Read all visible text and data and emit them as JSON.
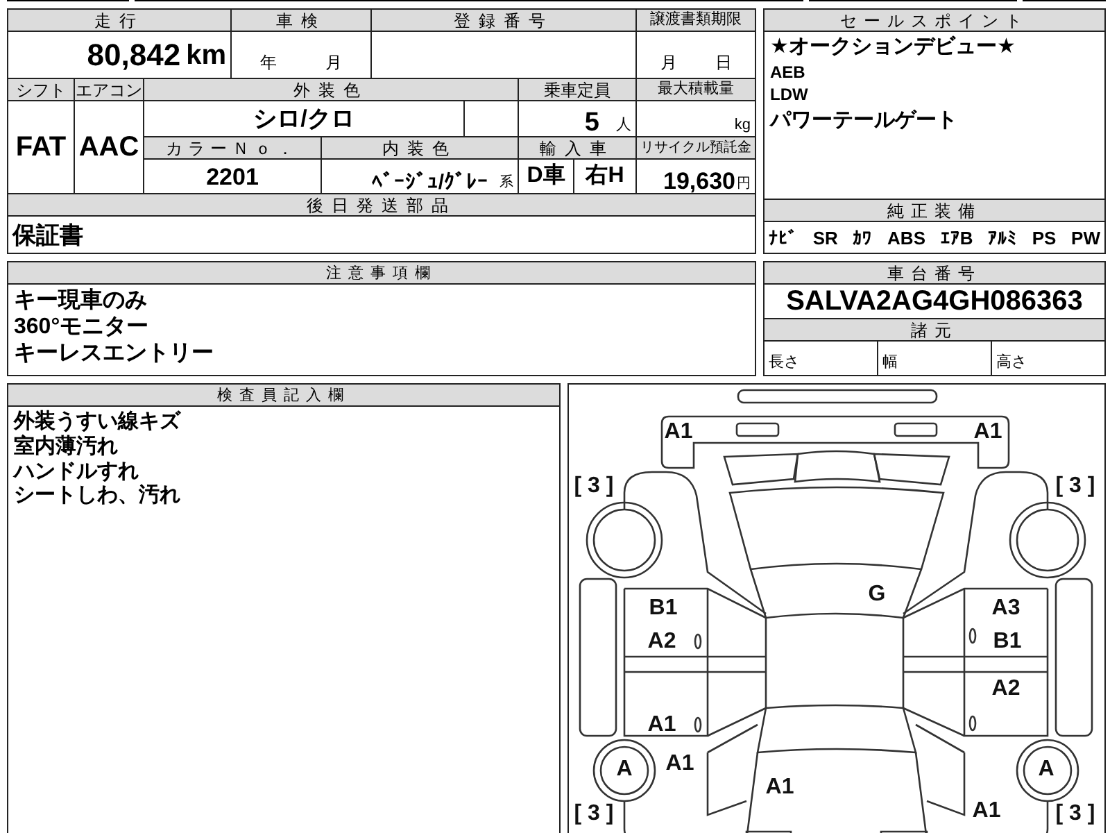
{
  "top_table": {
    "mileage": {
      "label": "走行",
      "value": "80,842",
      "unit": "km"
    },
    "inspection": {
      "label": "車検",
      "year_unit": "年",
      "month_unit": "月"
    },
    "registration_number": {
      "label": "登録番号"
    },
    "transfer_deadline": {
      "label": "譲渡書類期限",
      "month_unit": "月",
      "day_unit": "日"
    },
    "shift": {
      "label": "シフト",
      "value": "FAT"
    },
    "air_conditioning": {
      "label": "エアコン",
      "value": "AAC"
    },
    "exterior_color": {
      "label": "外装色",
      "value": "シロ/クロ"
    },
    "seating_capacity": {
      "label": "乗車定員",
      "value": "5",
      "unit": "人"
    },
    "max_load": {
      "label": "最大積載量",
      "unit": "kg"
    },
    "color_number": {
      "label": "カラーＮｏ．",
      "value": "2201"
    },
    "interior_color": {
      "label": "内装色",
      "value": "ﾍﾞｰｼﾞｭ/ｸﾞﾚｰ",
      "suffix": "系"
    },
    "import": {
      "label": "輸入車",
      "values": [
        "D車",
        "右H"
      ]
    },
    "recycling_fee": {
      "label": "リサイクル預託金",
      "value": "19,630",
      "unit": "円"
    },
    "later_parts": {
      "label": "後日発送部品",
      "value": "保証書"
    }
  },
  "sales_points": {
    "label": "セールスポイント",
    "items": [
      "★オークションデビュー★",
      "AEB",
      "LDW",
      "パワーテールゲート"
    ]
  },
  "equipment": {
    "label": "純正装備",
    "items": [
      "ﾅﾋﾞ",
      "SR",
      "ｶﾜ",
      "ABS",
      "ｴｱB",
      "ｱﾙﾐ",
      "PS",
      "PW"
    ]
  },
  "notes": {
    "label": "注意事項欄",
    "lines": [
      "キー現車のみ",
      "360°モニター",
      "キーレスエントリー"
    ]
  },
  "chassis": {
    "label": "車台番号",
    "value": "SALVA2AG4GH086363"
  },
  "specs": {
    "label": "諸元",
    "fields": [
      "長さ",
      "幅",
      "高さ"
    ]
  },
  "inspector_notes": {
    "label": "検査員記入欄",
    "lines": [
      "外装うすい線キズ",
      "室内薄汚れ",
      "ハンドルすれ",
      "シートしわ、汚れ"
    ]
  },
  "damage_diagram": {
    "marks": [
      "A1",
      "A1",
      "[ 3 ]",
      "[ 3 ]",
      "G",
      "B1",
      "A3",
      "A2",
      "B1",
      "A2",
      "A1",
      "A",
      "A1",
      "A",
      "A1",
      "[ 3 ]",
      "A1",
      "[ 3 ]"
    ]
  }
}
